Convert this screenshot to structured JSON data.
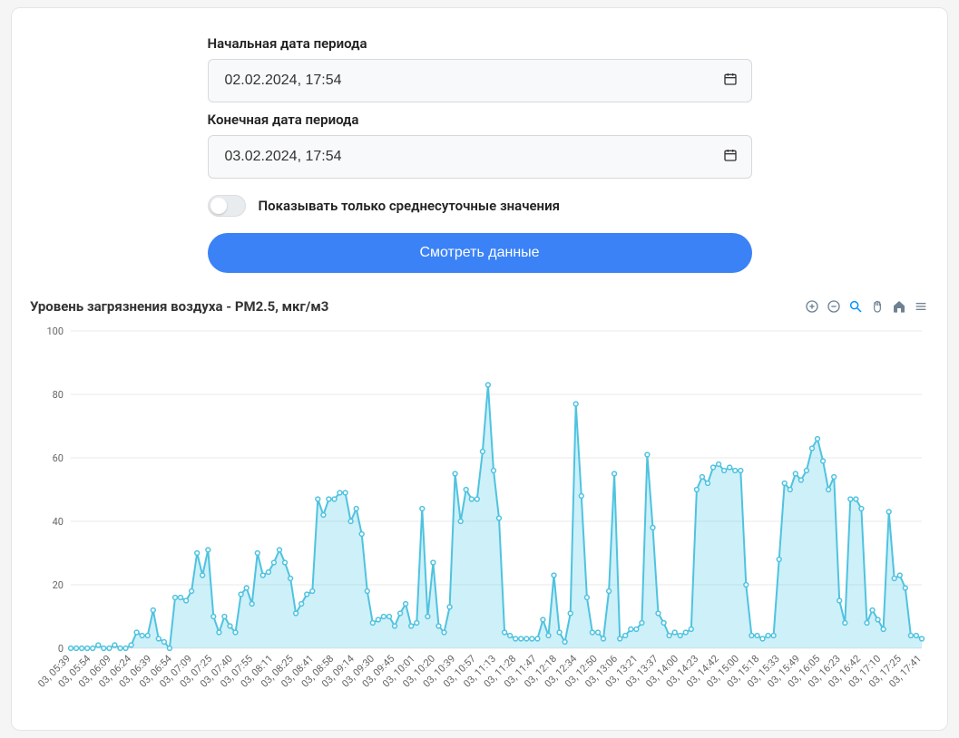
{
  "form": {
    "start_label": "Начальная дата периода",
    "start_value": "02.02.2024, 17:54",
    "end_label": "Конечная дата периода",
    "end_value": "03.02.2024, 17:54",
    "toggle_label": "Показывать только среднесуточные значения",
    "submit_label": "Смотреть данные"
  },
  "chart_title": "Уровень загрязнения воздуха - PM2.5, мкг/м3",
  "chart_data": {
    "type": "area",
    "title": "Уровень загрязнения воздуха - PM2.5, мкг/м3",
    "xlabel": "",
    "ylabel": "",
    "ylim": [
      0,
      100
    ],
    "yticks": [
      0,
      20,
      40,
      60,
      80,
      100
    ],
    "categories": [
      "03, 05:39",
      "03, 05:54",
      "03, 06:09",
      "03, 06:24",
      "03, 06:39",
      "03, 06:54",
      "03, 07:09",
      "03, 07:25",
      "03, 07:40",
      "03, 07:55",
      "03, 08:11",
      "03, 08:25",
      "03, 08:41",
      "03, 08:58",
      "03, 09:14",
      "03, 09:30",
      "03, 09:45",
      "03, 10:01",
      "03, 10:20",
      "03, 10:39",
      "03, 10:57",
      "03, 11:13",
      "03, 11:28",
      "03, 11:47",
      "03, 12:18",
      "03, 12:34",
      "03, 12:50",
      "03, 13:06",
      "03, 13:21",
      "03, 13:37",
      "03, 14:00",
      "03, 14:23",
      "03, 14:42",
      "03, 15:00",
      "03, 15:18",
      "03, 15:33",
      "03, 15:49",
      "03, 16:05",
      "03, 16:23",
      "03, 16:42",
      "03, 17:10",
      "03, 17:25",
      "03, 17:41"
    ],
    "values": [
      0,
      0,
      0,
      0,
      0,
      1,
      0,
      0,
      1,
      0,
      0,
      1,
      5,
      4,
      4,
      12,
      3,
      2,
      0,
      16,
      16,
      15,
      18,
      30,
      23,
      31,
      10,
      5,
      10,
      7,
      5,
      17,
      19,
      14,
      30,
      23,
      24,
      27,
      31,
      27,
      22,
      11,
      14,
      17,
      18,
      47,
      42,
      47,
      47,
      49,
      49,
      40,
      44,
      36,
      18,
      8,
      9,
      10,
      10,
      7,
      11,
      14,
      7,
      8,
      44,
      10,
      27,
      7,
      5,
      13,
      55,
      40,
      50,
      47,
      47,
      62,
      83,
      56,
      41,
      5,
      4,
      3,
      3,
      3,
      3,
      3,
      9,
      4,
      23,
      5,
      2,
      11,
      77,
      48,
      16,
      5,
      5,
      3,
      18,
      55,
      3,
      4,
      6,
      6,
      8,
      61,
      38,
      11,
      8,
      4,
      5,
      4,
      5,
      6,
      50,
      54,
      52,
      57,
      58,
      56,
      57,
      56,
      56,
      20,
      4,
      4,
      3,
      4,
      4,
      28,
      52,
      50,
      55,
      53,
      56,
      63,
      66,
      59,
      50,
      54,
      15,
      8,
      47,
      47,
      44,
      8,
      12,
      9,
      6,
      43,
      22,
      23,
      19,
      4,
      4,
      3
    ],
    "color": "#4fc3e0"
  }
}
